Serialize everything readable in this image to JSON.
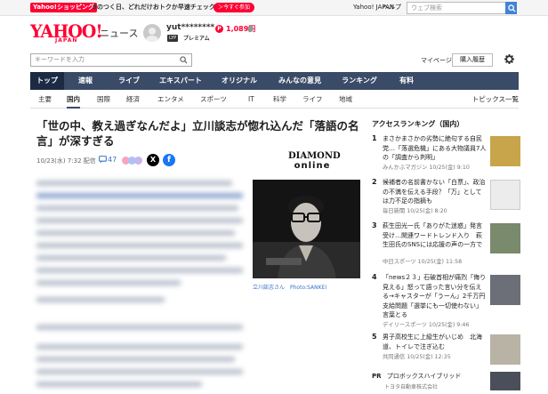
{
  "topbar": {
    "shopping_label": "Yahoo!ショッピング",
    "promo_text": "5のつく日、どれだけおトクか早速チェック",
    "promo_button": "＞今すぐ参加",
    "links": [
      "Yahoo! JAPAN",
      "ヘルプ"
    ],
    "search_placeholder": "ウェブ検索"
  },
  "header": {
    "logo_main": "YAHOO!",
    "logo_sub": "JAPAN",
    "logo_news": "ニュース",
    "username": "yut********",
    "lyp_badge": "LYP",
    "premium": "プレミアム",
    "points_icon": "P",
    "points": "1,089円",
    "keyword_placeholder": "キーワードを入力",
    "mypage": "マイページ",
    "history": "購入履歴"
  },
  "main_nav": [
    "トップ",
    "速報",
    "ライブ",
    "エキスパート",
    "オリジナル",
    "みんなの意見",
    "ランキング",
    "有料"
  ],
  "main_nav_active": 0,
  "sub_nav": [
    "主要",
    "国内",
    "国際",
    "経済",
    "エンタメ",
    "スポーツ",
    "IT",
    "科学",
    "ライフ",
    "地域"
  ],
  "sub_nav_active": 1,
  "sub_nav_topics": "トピックス一覧",
  "article": {
    "title": "「世の中、教え過ぎなんだよ」立川談志が惚れ込んだ「落語の名言」が深すぎる",
    "date": "10/23(水) 7:32 配信",
    "comment_count": "47",
    "publisher_logo_line1": "DIAMOND",
    "publisher_logo_line2": "online",
    "photo_caption": "立川談志さん　Photo:SANKEI"
  },
  "ranking": {
    "title": "アクセスランキング（国内）",
    "items": [
      {
        "rank": "1",
        "text": "まさかまさかの劣勢に絶句する自民党…「落選危機」にある大物議員7人の「調査から判明」",
        "meta": "みんかぶマガジン 10/25(金) 9:10"
      },
      {
        "rank": "2",
        "text": "候補者の名前書かない「白票」、政治の不満を伝える手段？「万」としては力不足の指摘も",
        "meta": "毎日新聞 10/25(金) 8:20"
      },
      {
        "rank": "3",
        "text": "萩生田光一氏「ありがた迷惑」発言受け…関連ワードトレンド入り　萩生田氏のSNSには応援の声の一方で「国民を侮辱」苦言も",
        "meta": "中日スポーツ 10/25(金) 11:58"
      },
      {
        "rank": "4",
        "text": "「news２３」石破首相が痛烈「侮り見える」怒って語った言い分を伝える→キャスターが「うーん」2千万円支給問題「選挙にも一切使わない」言葉とる",
        "meta": "デイリースポーツ 10/25(金) 9:46"
      },
      {
        "rank": "5",
        "text": "男子高校生に上級生がいじめ　北海道、トイレで注ぎ込む",
        "meta": "共同通信 10/25(金) 12:35"
      }
    ],
    "pr_label": "PR",
    "pr_text": "プロボックスハイブリッド",
    "pr_sub": "トヨタ自動車株式会社"
  },
  "colors": {
    "brand_red": "#ff0033",
    "nav_bg": "#3a4b67",
    "link_blue": "#3a72c9"
  }
}
